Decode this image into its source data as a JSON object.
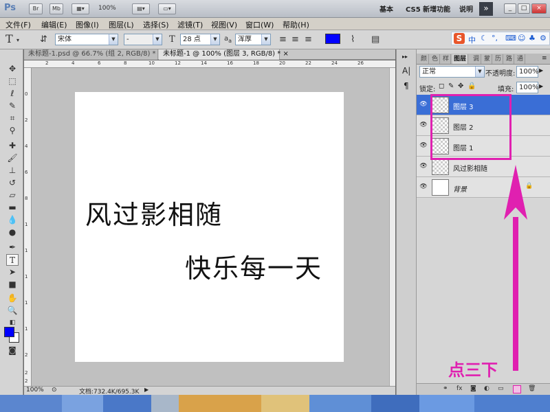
{
  "app": {
    "logo": "Ps",
    "bridge_label": "Br",
    "mini_bridge_label": "Mb",
    "zoom": "100%",
    "workspaces": [
      "基本",
      "CS5 新增功能",
      "说明"
    ],
    "more_label": "»"
  },
  "menu": [
    "文件(F)",
    "编辑(E)",
    "图像(I)",
    "图层(L)",
    "选择(S)",
    "滤镜(T)",
    "视图(V)",
    "窗口(W)",
    "帮助(H)"
  ],
  "options": {
    "font_family": "宋体",
    "font_style": "-",
    "font_size": "28 点",
    "aa_label": "a",
    "antialias": "浑厚",
    "text_color": "#0000ff"
  },
  "ime": {
    "label": "中"
  },
  "tabs": [
    {
      "label": "未标题-1.psd @ 66.7% (组 2, RGB/8) *",
      "close": "×"
    },
    {
      "label": "未标题-1 @ 100% (图层 3, RGB/8) *",
      "close": "×"
    }
  ],
  "ruler": {
    "top": [
      "2",
      "4",
      "6",
      "8",
      "10",
      "12",
      "14",
      "16",
      "18",
      "20",
      "22",
      "24",
      "26"
    ],
    "left": [
      "0",
      "2",
      "4",
      "6",
      "8",
      "1",
      "1",
      "1",
      "1",
      "1",
      "2",
      "2",
      "2"
    ]
  },
  "canvas": {
    "line1": "风过影相随",
    "line2": "快乐每一天"
  },
  "status": {
    "zoom": "100%",
    "doc": "文档:732.4K/695.3K"
  },
  "panel": {
    "tabs": [
      "颜",
      "色",
      "样",
      "图层",
      "调",
      "蒙",
      "历",
      "路",
      "通"
    ],
    "blend_mode": "正常",
    "opacity_label": "不透明度:",
    "opacity": "100%",
    "lock_label": "锁定:",
    "fill_label": "填充:",
    "fill": "100%",
    "layers": [
      {
        "name": "图层 3",
        "selected": true
      },
      {
        "name": "图层 2",
        "selected": false
      },
      {
        "name": "图层 1",
        "selected": false
      },
      {
        "name": "风过影相随",
        "selected": false
      },
      {
        "name": "背景",
        "selected": false,
        "locked": true
      }
    ]
  },
  "annotation": {
    "text": "点三下",
    "color": "#e020b0"
  },
  "colors": {
    "foreground": "#0000ff",
    "background": "#ffffff",
    "selection": "#3a6ed6"
  },
  "icons": [
    "move-tool-icon",
    "marquee-tool-icon",
    "lasso-tool-icon",
    "quick-select-icon",
    "crop-tool-icon",
    "eyedropper-icon",
    "healing-brush-icon",
    "brush-tool-icon",
    "clone-stamp-icon",
    "history-brush-icon",
    "eraser-icon",
    "gradient-icon",
    "blur-icon",
    "dodge-icon",
    "pen-tool-icon",
    "type-tool-icon",
    "path-select-icon",
    "shape-tool-icon",
    "hand-tool-icon",
    "zoom-tool-icon",
    "eye-icon",
    "lock-icon",
    "new-layer-icon"
  ]
}
